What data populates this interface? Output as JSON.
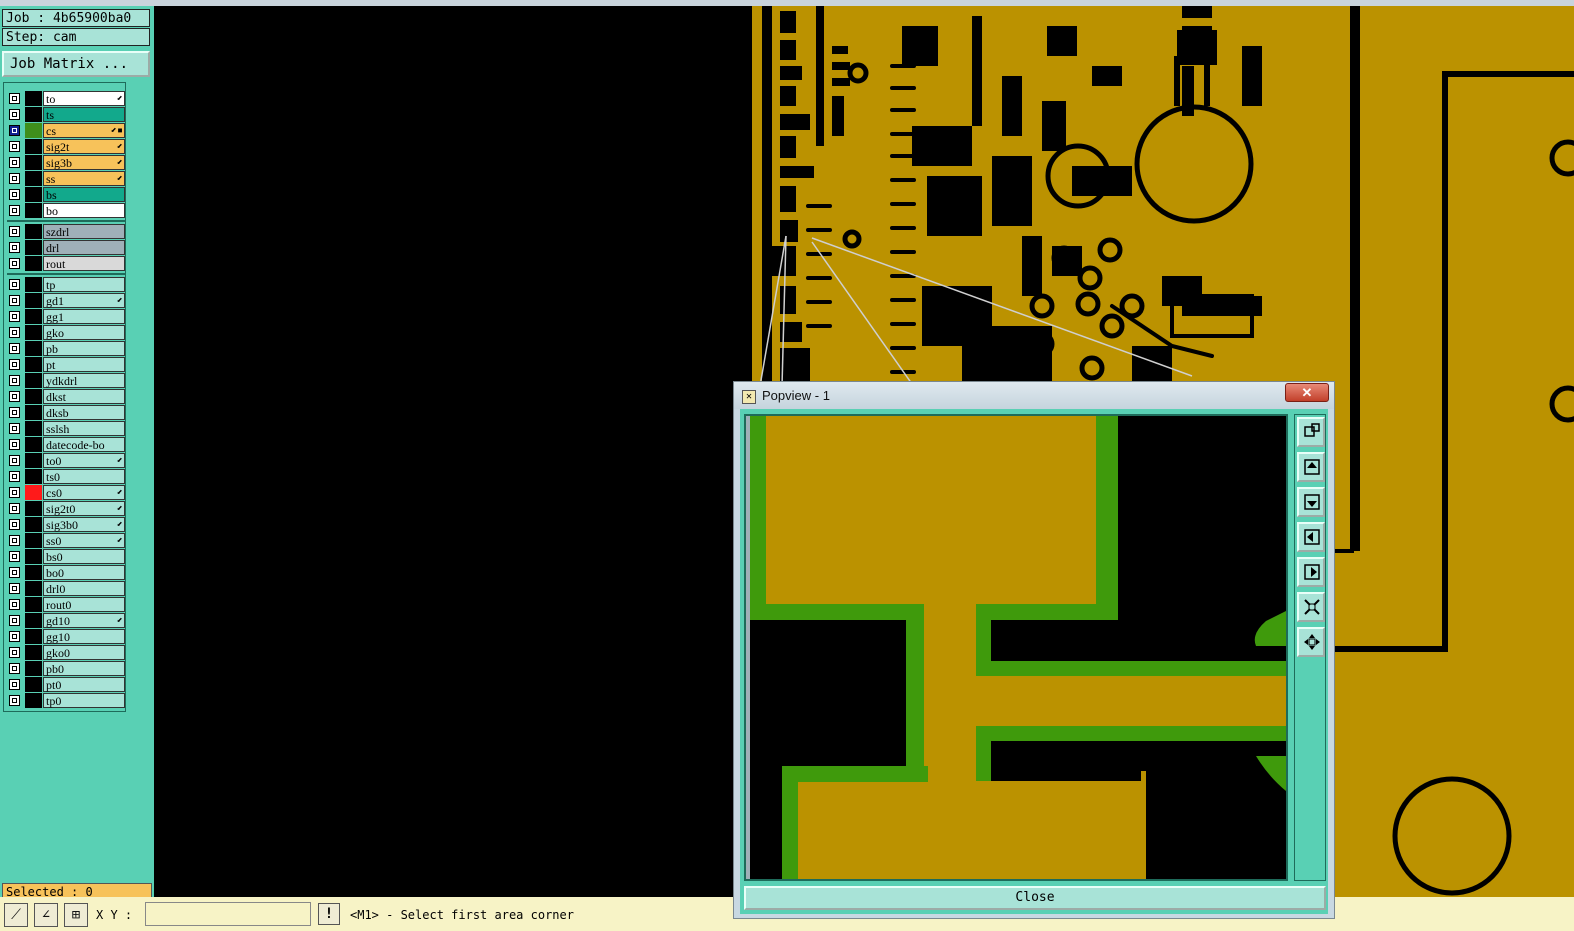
{
  "header": {
    "job": "Job : 4b65900ba0",
    "step": "Step: cam",
    "job_matrix_button": "Job Matrix ..."
  },
  "layers": [
    {
      "name": "to",
      "bg": "#ffffff",
      "mark": "⬋"
    },
    {
      "name": "ts",
      "bg": "#12a98c",
      "mark": ""
    },
    {
      "name": "cs",
      "bg": "#f7c25a",
      "mark": "⬋▪",
      "affected_color": "#3f8e1c",
      "selected": true
    },
    {
      "name": "sig2t",
      "bg": "#f7c25a",
      "mark": "⬋"
    },
    {
      "name": "sig3b",
      "bg": "#f7c25a",
      "mark": "⬋"
    },
    {
      "name": "ss",
      "bg": "#f7c25a",
      "mark": "⬋"
    },
    {
      "name": "bs",
      "bg": "#12a98c",
      "mark": ""
    },
    {
      "name": "bo",
      "bg": "#ffffff",
      "mark": ""
    },
    {
      "name": "szdrl",
      "bg": "#9fb0b8",
      "mark": ""
    },
    {
      "name": "drl",
      "bg": "#9fb0b8",
      "mark": ""
    },
    {
      "name": "rout",
      "bg": "#d9d9d9",
      "mark": ""
    },
    {
      "name": "tp",
      "bg": "#a8e3d7",
      "mark": ""
    },
    {
      "name": "gd1",
      "bg": "#a8e3d7",
      "mark": "⬋"
    },
    {
      "name": "gg1",
      "bg": "#a8e3d7",
      "mark": ""
    },
    {
      "name": "gko",
      "bg": "#a8e3d7",
      "mark": ""
    },
    {
      "name": "pb",
      "bg": "#a8e3d7",
      "mark": ""
    },
    {
      "name": "pt",
      "bg": "#a8e3d7",
      "mark": ""
    },
    {
      "name": "ydkdrl",
      "bg": "#a8e3d7",
      "mark": ""
    },
    {
      "name": "dkst",
      "bg": "#a8e3d7",
      "mark": ""
    },
    {
      "name": "dksb",
      "bg": "#a8e3d7",
      "mark": ""
    },
    {
      "name": "sslsh",
      "bg": "#a8e3d7",
      "mark": ""
    },
    {
      "name": "datecode-bo",
      "bg": "#a8e3d7",
      "mark": ""
    },
    {
      "name": "to0",
      "bg": "#a8e3d7",
      "mark": "⬋"
    },
    {
      "name": "ts0",
      "bg": "#a8e3d7",
      "mark": ""
    },
    {
      "name": "cs0",
      "bg": "#a8e3d7",
      "mark": "⬋",
      "affected_color": "#ff1a1a"
    },
    {
      "name": "sig2t0",
      "bg": "#a8e3d7",
      "mark": "⬋"
    },
    {
      "name": "sig3b0",
      "bg": "#a8e3d7",
      "mark": "⬋"
    },
    {
      "name": "ss0",
      "bg": "#a8e3d7",
      "mark": "⬋"
    },
    {
      "name": "bs0",
      "bg": "#a8e3d7",
      "mark": ""
    },
    {
      "name": "bo0",
      "bg": "#a8e3d7",
      "mark": ""
    },
    {
      "name": "drl0",
      "bg": "#a8e3d7",
      "mark": ""
    },
    {
      "name": "rout0",
      "bg": "#a8e3d7",
      "mark": ""
    },
    {
      "name": "gd10",
      "bg": "#a8e3d7",
      "mark": "⬋"
    },
    {
      "name": "gg10",
      "bg": "#a8e3d7",
      "mark": ""
    },
    {
      "name": "gko0",
      "bg": "#a8e3d7",
      "mark": ""
    },
    {
      "name": "pb0",
      "bg": "#a8e3d7",
      "mark": ""
    },
    {
      "name": "pt0",
      "bg": "#a8e3d7",
      "mark": ""
    },
    {
      "name": "tp0",
      "bg": "#a8e3d7",
      "mark": ""
    }
  ],
  "selected_label": "Selected : 0",
  "status": {
    "xy_label": "X Y :",
    "xy_value": "",
    "bang": "!",
    "prompt": "<M1> - Select first area corner",
    "tool_icons": [
      "select-area-icon",
      "measure-icon",
      "grid-snap-icon"
    ]
  },
  "popview": {
    "title": "Popview - 1",
    "close_x": "✕",
    "close_button": "Close",
    "tools": [
      "zoom-window-icon",
      "pan-up-icon",
      "pan-down-icon",
      "pan-left-icon",
      "pan-right-icon",
      "zoom-fit-icon",
      "pan-center-icon"
    ]
  },
  "colors": {
    "copper": "#bb9200",
    "feature_green": "#3f9a0c",
    "panel": "#59d0b4",
    "panel_light": "#a8e3d7"
  }
}
